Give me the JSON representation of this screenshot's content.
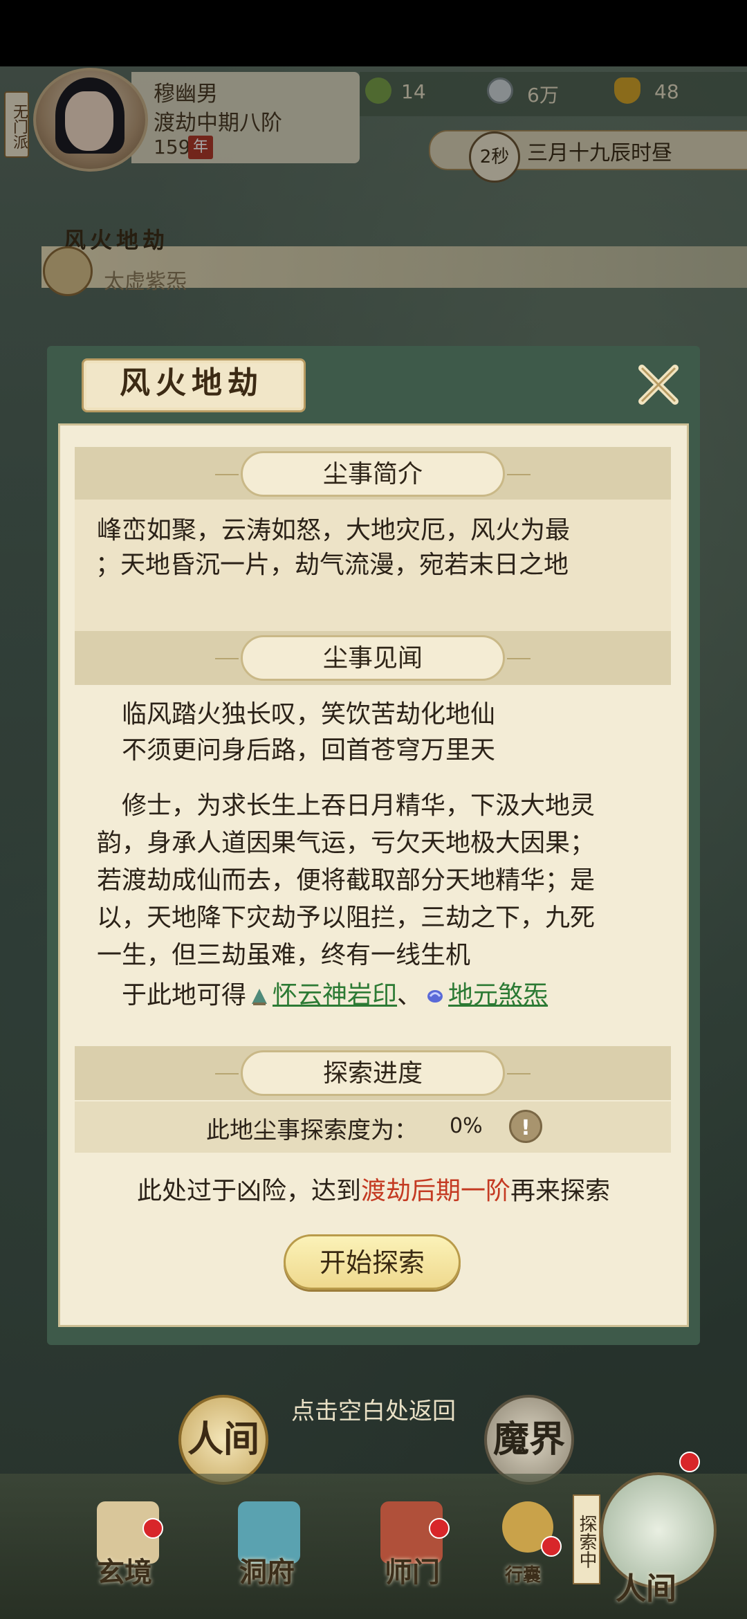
{
  "hud": {
    "sect": "无门派",
    "player_name": "穆幽男",
    "player_rank": "渡劫中期八阶",
    "age": "159",
    "age_unit": "年",
    "resources": [
      {
        "icon": "leaf-icon",
        "value": "14"
      },
      {
        "icon": "coin-icon",
        "value": "6万"
      },
      {
        "icon": "ingot-icon",
        "value": "48"
      }
    ],
    "timer": "2秒",
    "date_text": "三月十九辰时昼"
  },
  "realm": {
    "title": "风火地劫",
    "sub": "太虚紫炁"
  },
  "modal": {
    "title": "风火地劫",
    "section1": "尘事简介",
    "intro_l1": "峰峦如聚，云涛如怒，大地灾厄，风火为最",
    "intro_l2": "；天地昏沉一片，劫气流漫，宛若末日之地",
    "section2": "尘事见闻",
    "poem_l1": "临风踏火独长叹，笑饮苦劫化地仙",
    "poem_l2": "不须更问身后路，回首苍穹万里天",
    "story_l1": "修士，为求长生上吞日月精华，下汲大地灵",
    "story_l2": "韵，身承人道因果气运，亏欠天地极大因果；",
    "story_l3": "若渡劫成仙而去，便将截取部分天地精华；是",
    "story_l4": "以，天地降下灾劫予以阻拦，三劫之下，九死",
    "story_l5": "一生，但三劫虽难，终有一线生机",
    "obtain_prefix": "于此地可得",
    "item1": "怀云神岩印",
    "separator": "、",
    "item2": "地元煞炁",
    "section3": "探索进度",
    "progress_label": "此地尘事探索度为：",
    "progress_value": "0%",
    "warn_prefix": "此处过于凶险，达到",
    "warn_red": "渡劫后期一阶",
    "warn_suffix": "再来探索",
    "explore_button": "开始探索"
  },
  "tap_hint": "点击空白处返回",
  "worlds": {
    "human": "人间",
    "demon": "魔界"
  },
  "nav": {
    "items": [
      "玄境",
      "洞府",
      "师门",
      "行囊"
    ],
    "exploring": "探索中",
    "current": "人间"
  }
}
